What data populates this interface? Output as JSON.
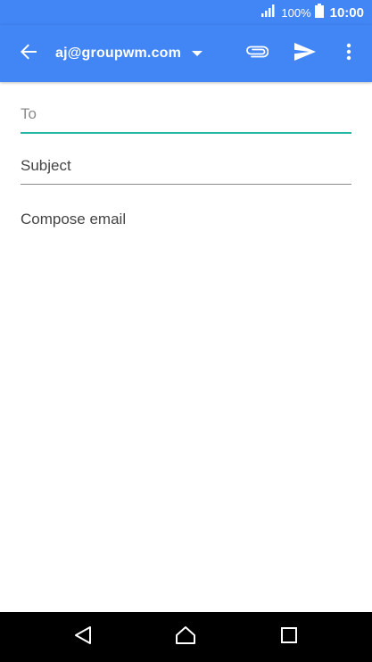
{
  "status_bar": {
    "battery_percent": "100%",
    "time": "10:00",
    "icons": [
      "signal-icon",
      "battery-icon"
    ]
  },
  "app_bar": {
    "account_email": "aj@groupwm.com",
    "icons": [
      "back-arrow-icon",
      "dropdown-icon",
      "paperclip-icon",
      "send-icon",
      "more-vert-icon"
    ],
    "color": "#4285f4"
  },
  "compose": {
    "to_placeholder": "To",
    "subject_placeholder": "Subject",
    "body_placeholder": "Compose email",
    "focus_accent": "#26b7a5"
  },
  "nav_bar": {
    "icons": [
      "nav-back-icon",
      "nav-home-icon",
      "nav-recents-icon"
    ]
  }
}
